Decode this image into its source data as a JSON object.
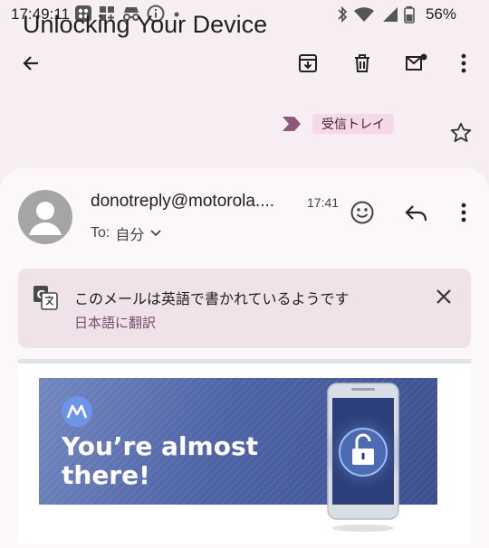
{
  "status_bar": {
    "time": "17:49:11",
    "battery": "56%"
  },
  "email": {
    "subject": "Unlocking Your Device",
    "label": "受信トレイ",
    "sender": "donotreply@motorola....",
    "time": "17:41",
    "to_prefix": "To:",
    "to_name": "自分"
  },
  "translate": {
    "message": "このメールは英語で書かれているようです",
    "action": "日本語に翻訳"
  },
  "banner": {
    "title": "You’re almost there!"
  },
  "colors": {
    "background": "#f6eef2",
    "label_chip": "#f5d9e9",
    "translate_link": "#7a4a6a",
    "banner": "#4e63a6"
  },
  "icons": [
    "back-arrow-icon",
    "archive-icon",
    "delete-icon",
    "mark-unread-icon",
    "more-vert-icon",
    "label-arrow-icon",
    "star-icon",
    "emoji-icon",
    "reply-icon",
    "chevron-down-icon",
    "translate-icon",
    "close-icon"
  ]
}
